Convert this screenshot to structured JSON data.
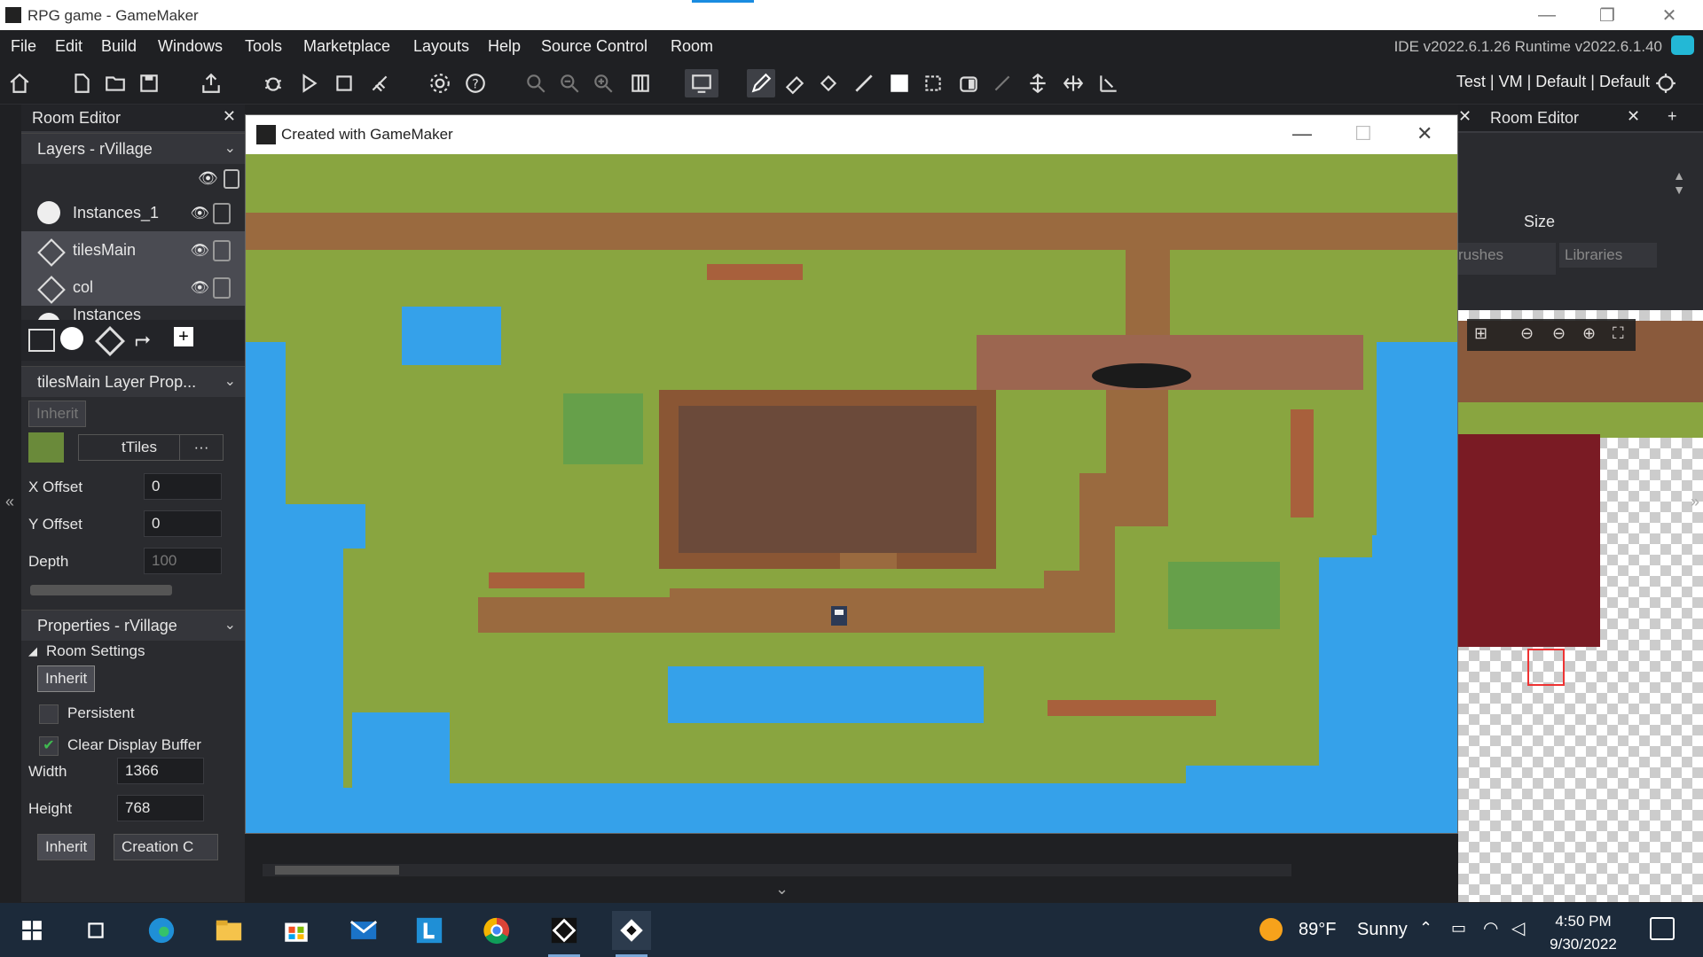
{
  "window": {
    "title": "RPG game - GameMaker"
  },
  "menu": [
    "File",
    "Edit",
    "Build",
    "Windows",
    "Tools",
    "Marketplace",
    "Layouts",
    "Help",
    "Source Control",
    "Room"
  ],
  "version": "IDE v2022.6.1.26  Runtime v2022.6.1.40",
  "targets": "Test | VM | Default | Default",
  "left_panel": {
    "tab_title": "Room Editor",
    "layers_header": "Layers - rVillage",
    "layers": [
      {
        "name": "Instances_1"
      },
      {
        "name": "tilesMain"
      },
      {
        "name": "col"
      },
      {
        "name": "Instances"
      }
    ],
    "layer_props_header": "tilesMain Layer Prop...",
    "inherit_label": "Inherit",
    "tileset_name": "tTiles",
    "more_label": "···",
    "x_offset_label": "X Offset",
    "x_offset_value": "0",
    "y_offset_label": "Y Offset",
    "y_offset_value": "0",
    "depth_label": "Depth",
    "depth_value": "100",
    "properties_header": "Properties - rVillage",
    "room_settings_label": "Room Settings",
    "inherit2_label": "Inherit",
    "persistent_label": "Persistent",
    "clear_display_label": "Clear Display Buffer",
    "width_label": "Width",
    "width_value": "1366",
    "height_label": "Height",
    "height_value": "768",
    "inherit3_label": "Inherit",
    "creation_label": "Creation C"
  },
  "game_window": {
    "title": "Created with GameMaker"
  },
  "right_panel": {
    "tab_title": "Room Editor",
    "size_label": "Size",
    "brushes_label": "rushes",
    "libraries_label": "Libraries"
  },
  "taskbar": {
    "weather_temp": "89°F",
    "weather_desc": "Sunny",
    "time": "4:50 PM",
    "date": "9/30/2022"
  },
  "colors": {
    "grass": "#89a540",
    "water": "#35a1ea",
    "dirt": "#9a6a3f",
    "brick": "#6b4a3a",
    "accent": "#1a8ce0"
  }
}
